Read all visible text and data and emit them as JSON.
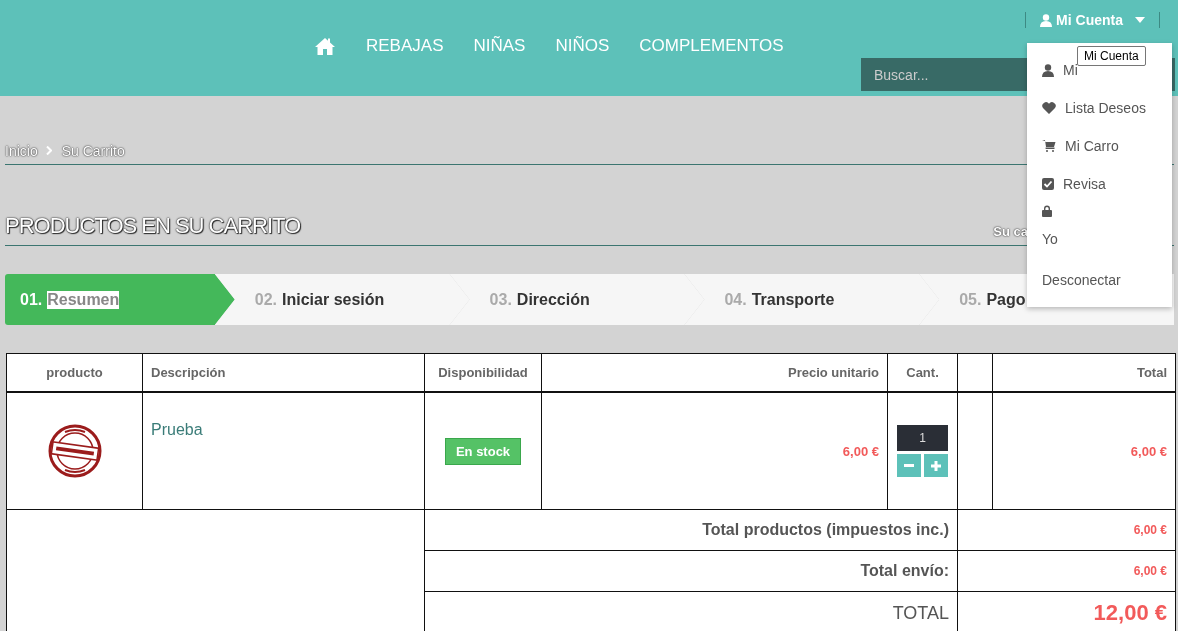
{
  "nav": [
    {
      "kind": "home"
    },
    {
      "kind": "link",
      "label": "REBAJAS"
    },
    {
      "kind": "link",
      "label": "NIÑAS"
    },
    {
      "kind": "link",
      "label": "NIÑOS"
    },
    {
      "kind": "link",
      "label": "COMPLEMENTOS"
    }
  ],
  "account": {
    "label": "Mi Cuenta",
    "expanded": true
  },
  "search": {
    "placeholder": "Buscar..."
  },
  "account_menu": [
    {
      "kind": "user",
      "label": "Mi"
    },
    {
      "kind": "heart",
      "label": "Lista Deseos"
    },
    {
      "kind": "cart",
      "label": "Mi Carro"
    },
    {
      "kind": "check",
      "label": "Revisa"
    },
    {
      "kind": "lock"
    },
    {
      "kind": "text",
      "label": "Yo"
    },
    {
      "kind": "text",
      "label": "Desconectar"
    }
  ],
  "tooltip": "Mi Cuenta",
  "breadcrumb": [
    "Inicio",
    "Su Carrito"
  ],
  "heading": "PRODUCTOS EN SU CARRITO",
  "heading_note": "Su ca",
  "steps": [
    {
      "number": "01.",
      "label": "Resumen",
      "selected": true
    },
    {
      "number": "02.",
      "label": "Iniciar sesión",
      "selected": false
    },
    {
      "number": "03.",
      "label": "Dirección",
      "selected": false
    },
    {
      "number": "04.",
      "label": "Transporte",
      "selected": false
    },
    {
      "number": "05.",
      "label": "Pago",
      "selected": false
    }
  ],
  "table": {
    "columns": [
      "producto",
      "Descripción",
      "Disponibilidad",
      "Precio unitario",
      "Cant.",
      "",
      "Total"
    ],
    "rows": [
      {
        "description": "Prueba",
        "availability": "En stock",
        "unit_price": "6,00 €",
        "quantity": "1",
        "total": "6,00 €"
      }
    ],
    "summary": [
      {
        "kind": "normal",
        "label": "Total productos (impuestos inc.)",
        "value": "6,00 €"
      },
      {
        "kind": "normal",
        "label": "Total envío:",
        "value": "6,00 €"
      },
      {
        "kind": "grand",
        "label": "TOTAL",
        "value": "12,00 €"
      }
    ]
  }
}
